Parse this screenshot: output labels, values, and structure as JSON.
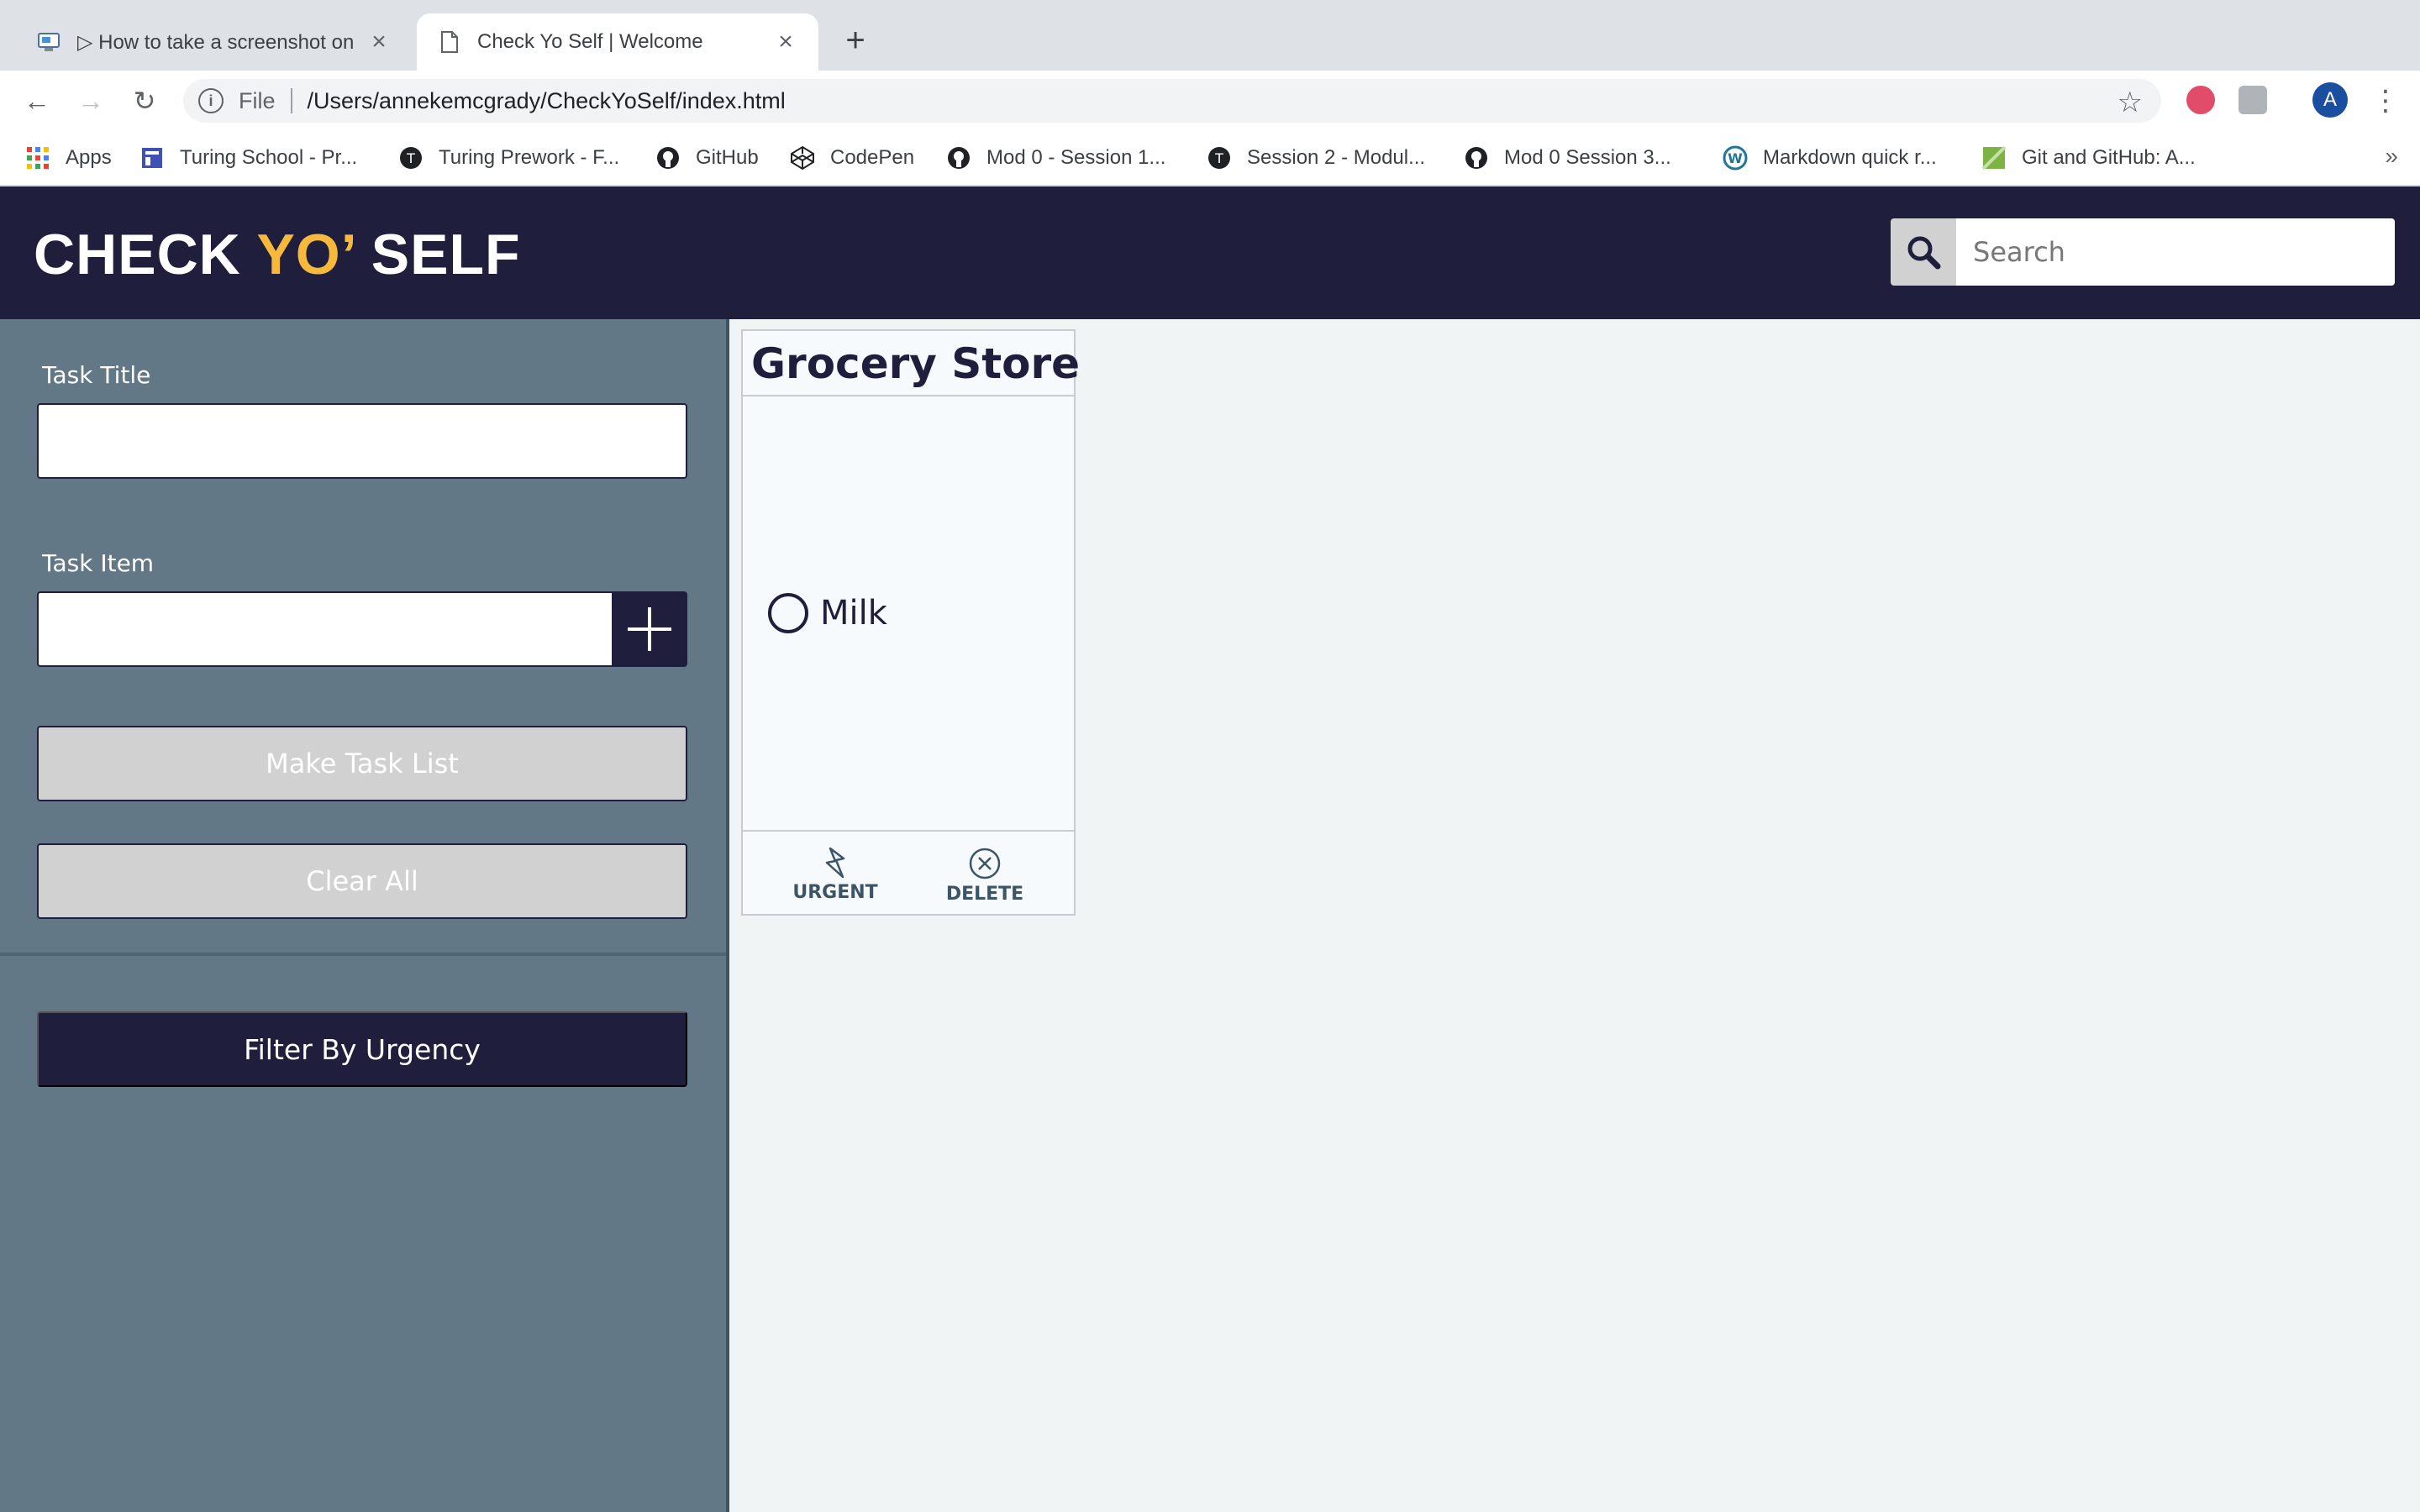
{
  "browser": {
    "tabs": [
      {
        "title": "▷ How to take a screenshot on",
        "active": false
      },
      {
        "title": "Check Yo Self | Welcome",
        "active": true
      }
    ],
    "new_tab": "+",
    "omnibox": {
      "scheme": "File",
      "url": "/Users/annekemcgrady/CheckYoSelf/index.html"
    },
    "profile_initial": "A",
    "bookmarks": [
      {
        "label": "Apps",
        "icon": "apps-grid-icon"
      },
      {
        "label": "Turing School - Pr...",
        "icon": "turing-icon"
      },
      {
        "label": "Turing Prework - F...",
        "icon": "turing-logo-icon"
      },
      {
        "label": "GitHub",
        "icon": "github-icon"
      },
      {
        "label": "CodePen",
        "icon": "codepen-icon"
      },
      {
        "label": "Mod 0 - Session 1...",
        "icon": "github-icon"
      },
      {
        "label": "Session 2 - Modul...",
        "icon": "turing-logo-icon"
      },
      {
        "label": "Mod 0 Session 3...",
        "icon": "github-icon"
      },
      {
        "label": "Markdown quick r...",
        "icon": "wordpress-icon"
      },
      {
        "label": "Git and GitHub: A...",
        "icon": "bookmark-image-icon"
      }
    ],
    "bookmarks_more": "»"
  },
  "app": {
    "logo": {
      "part1": "CHECK ",
      "part2": "YO’",
      "part3": " SELF"
    },
    "colors": {
      "navy": "#1f1f3d",
      "accent": "#f6b93b",
      "sidebar": "#627887",
      "main_bg": "#f0f4f5"
    },
    "search": {
      "placeholder": "Search"
    },
    "sidebar": {
      "task_title_label": "Task Title",
      "task_item_label": "Task Item",
      "make_task_list": "Make Task List",
      "clear_all": "Clear All",
      "filter_by_urgency": "Filter By Urgency"
    },
    "cards": [
      {
        "title": "Grocery Store",
        "items": [
          "Milk"
        ],
        "urgent_label": "URGENT",
        "delete_label": "DELETE"
      }
    ]
  }
}
